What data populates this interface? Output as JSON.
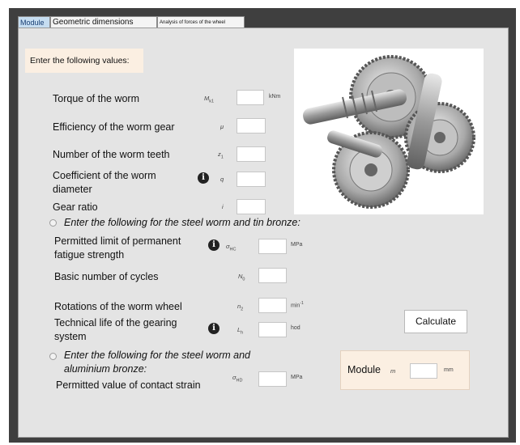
{
  "tabs": [
    {
      "label": "Module",
      "active": true
    },
    {
      "label": "Geometric dimensions",
      "active": false
    },
    {
      "label": "Analysis of forces of the wheel",
      "active": false
    }
  ],
  "header": {
    "text": "Enter the following values:"
  },
  "fields": {
    "torque": {
      "label": "Torque of the worm",
      "symbol": "M",
      "sub": "k1",
      "unit": "kNm",
      "value": ""
    },
    "efficiency": {
      "label": "Efficiency of the worm gear",
      "symbol": "μ",
      "value": ""
    },
    "teeth": {
      "label": "Number of the worm teeth",
      "symbol": "z",
      "sub": "1",
      "value": ""
    },
    "coefficient": {
      "label": "Coefficient of the worm diameter",
      "symbol": "q",
      "value": ""
    },
    "gear_ratio": {
      "label": "Gear ratio",
      "symbol": "i",
      "value": ""
    },
    "fatigue": {
      "label": "Permitted limit of permanent fatigue strength",
      "symbol": "σ",
      "sub": "HC",
      "unit": "MPa",
      "value": ""
    },
    "cycles": {
      "label": "Basic number of cycles",
      "symbol": "N",
      "sub": "0",
      "value": ""
    },
    "rotations": {
      "label": "Rotations of the worm wheel",
      "symbol": "n",
      "sub": "2",
      "unit": "min",
      "unit_sup": "-1",
      "value": ""
    },
    "life": {
      "label": "Technical life of the gearing system",
      "symbol": "L",
      "sub": "h",
      "unit": "hod",
      "value": ""
    },
    "contact_strain": {
      "label": "Permitted value of contact strain",
      "symbol": "σ",
      "sub": "HD",
      "unit": "MPa",
      "value": ""
    }
  },
  "options": {
    "tin_bronze": "Enter the following for the steel worm and tin bronze:",
    "aluminium_bronze_line1": "Enter the following for the steel worm and",
    "aluminium_bronze_line2": "aluminium bronze:"
  },
  "buttons": {
    "calculate": "Calculate"
  },
  "result": {
    "label": "Module",
    "symbol": "m",
    "unit": "mm",
    "value": ""
  },
  "icons": {
    "info": "i"
  }
}
